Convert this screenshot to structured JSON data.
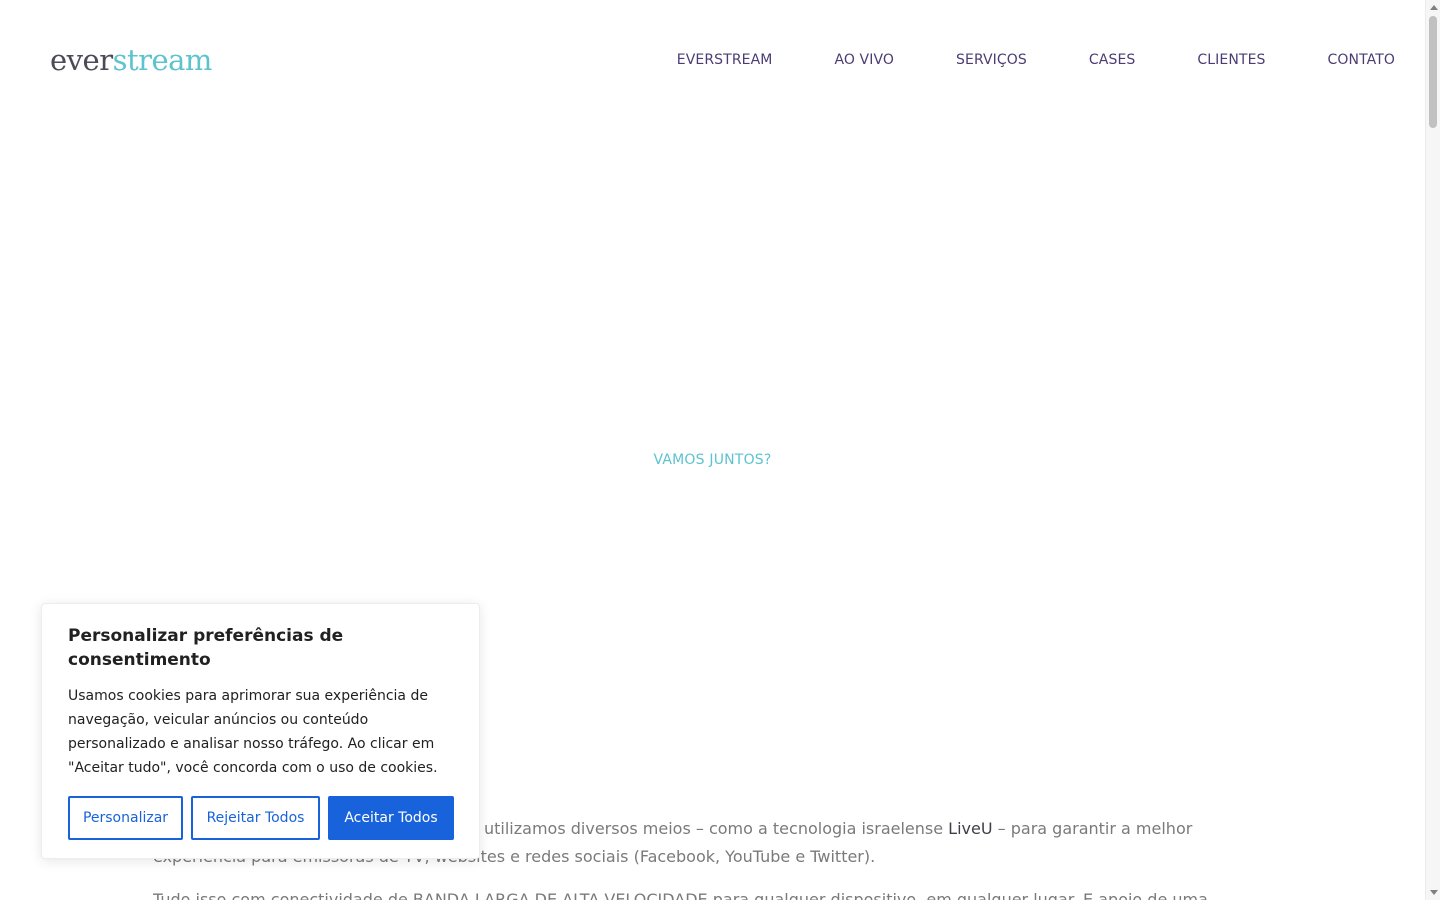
{
  "header": {
    "logo_part1": "ever",
    "logo_part2": "stream",
    "nav": [
      {
        "label": "EVERSTREAM"
      },
      {
        "label": "AO VIVO"
      },
      {
        "label": "SERVIÇOS"
      },
      {
        "label": "CASES"
      },
      {
        "label": "CLIENTES"
      },
      {
        "label": "CONTATO"
      }
    ]
  },
  "hero": {
    "cta": "VAMOS JUNTOS?"
  },
  "content": {
    "p1_start": "utilizamos diversos meios – como a tecnologia israelense ",
    "p1_link": "LiveU",
    "p1_end": " – para garantir a melhor experiência para emissoras de TV, websites e redes sociais (Facebook, YouTube e Twitter).",
    "p2": "Tudo isso com conectividade de BANDA LARGA DE ALTA VELOCIDADE para qualquer dispositivo, em qualquer lugar. E apoio de uma UNIDADE"
  },
  "cookie": {
    "title": "Personalizar preferências de consentimento",
    "text": "Usamos cookies para aprimorar sua experiência de navegação, veicular anúncios ou conteúdo personalizado e analisar nosso tráfego. Ao clicar em \"Aceitar tudo\", você concorda com o uso de cookies.",
    "btn_customize": "Personalizar",
    "btn_reject": "Rejeitar Todos",
    "btn_accept": "Aceitar Todos"
  },
  "colors": {
    "accent": "#5cc3cf",
    "nav": "#4d3c74",
    "button": "#1863dc"
  }
}
